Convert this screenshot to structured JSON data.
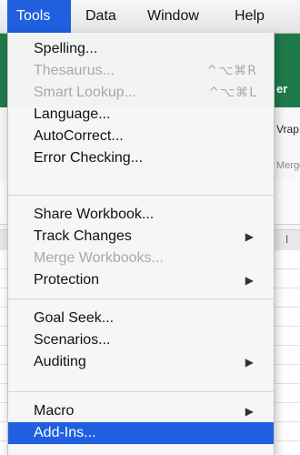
{
  "menubar": {
    "items": [
      {
        "label": "Tools",
        "active": true
      },
      {
        "label": "Data",
        "active": false
      },
      {
        "label": "Window",
        "active": false
      },
      {
        "label": "Help",
        "active": false
      }
    ]
  },
  "background": {
    "ribbon_tab_partial": "er",
    "wrap_text_partial": "Vrap",
    "merge_partial": "Merge",
    "column_letter_partial": "I"
  },
  "tools_menu": {
    "groups": [
      [
        {
          "label": "Spelling...",
          "shortcut": "",
          "enabled": true,
          "submenu": false
        },
        {
          "label": "Thesaurus...",
          "shortcut": "^⌥⌘R",
          "enabled": false,
          "submenu": false
        },
        {
          "label": "Smart Lookup...",
          "shortcut": "^⌥⌘L",
          "enabled": false,
          "submenu": false
        },
        {
          "label": "Language...",
          "shortcut": "",
          "enabled": true,
          "submenu": false
        },
        {
          "label": "AutoCorrect...",
          "shortcut": "",
          "enabled": true,
          "submenu": false
        },
        {
          "label": "Error Checking...",
          "shortcut": "",
          "enabled": true,
          "submenu": false
        }
      ],
      [
        {
          "label": "Share Workbook...",
          "shortcut": "",
          "enabled": true,
          "submenu": false
        },
        {
          "label": "Track Changes",
          "shortcut": "",
          "enabled": true,
          "submenu": true
        },
        {
          "label": "Merge Workbooks...",
          "shortcut": "",
          "enabled": false,
          "submenu": false
        },
        {
          "label": "Protection",
          "shortcut": "",
          "enabled": true,
          "submenu": true
        }
      ],
      [
        {
          "label": "Goal Seek...",
          "shortcut": "",
          "enabled": true,
          "submenu": false
        },
        {
          "label": "Scenarios...",
          "shortcut": "",
          "enabled": true,
          "submenu": false
        },
        {
          "label": "Auditing",
          "shortcut": "",
          "enabled": true,
          "submenu": true
        }
      ],
      [
        {
          "label": "Macro",
          "shortcut": "",
          "enabled": true,
          "submenu": true
        },
        {
          "label": "Add-Ins...",
          "shortcut": "",
          "enabled": true,
          "submenu": false,
          "highlighted": true
        }
      ]
    ],
    "submenu_arrow_icon": "triangle-right-icon",
    "submenu_arrow_glyph": "▶"
  },
  "colors": {
    "highlight": "#1f5fe0",
    "excel_green": "#1f7a4a",
    "disabled_text": "#a8a8a8"
  }
}
